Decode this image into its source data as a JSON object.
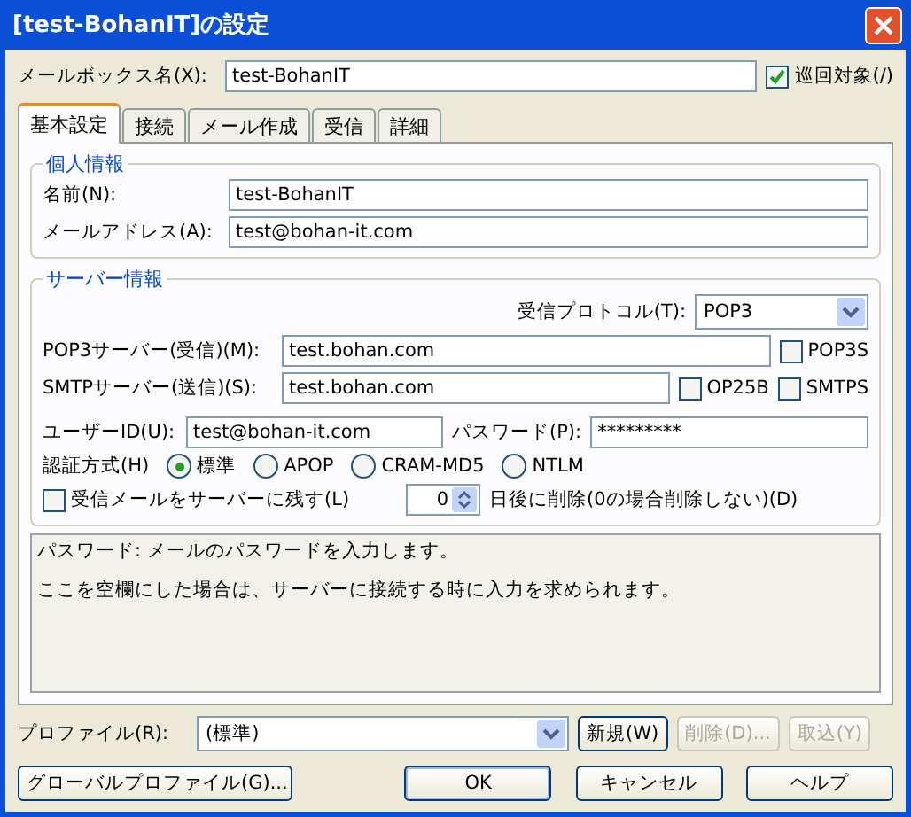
{
  "window": {
    "title": "[test-BohanIT]の設定"
  },
  "mailbox": {
    "label": "メールボックス名(X):",
    "value": "test-BohanIT",
    "patrol": {
      "label": "巡回対象(/)",
      "checked": true
    }
  },
  "tabs": [
    {
      "label": "基本設定",
      "selected": true
    },
    {
      "label": "接続",
      "selected": false
    },
    {
      "label": "メール作成",
      "selected": false
    },
    {
      "label": "受信",
      "selected": false
    },
    {
      "label": "詳細",
      "selected": false
    }
  ],
  "personal": {
    "title": "個人情報",
    "fields": [
      {
        "label": "名前(N):",
        "value": "test-BohanIT"
      },
      {
        "label": "メールアドレス(A):",
        "value": "test@bohan-it.com"
      }
    ]
  },
  "server": {
    "title": "サーバー情報",
    "protocol": {
      "label": "受信プロトコル(T):",
      "value": "POP3"
    },
    "pop3": {
      "label": "POP3サーバー(受信)(M):",
      "value": "test.bohan.com",
      "options": [
        {
          "label": "POP3S",
          "checked": false
        }
      ]
    },
    "smtp": {
      "label": "SMTPサーバー(送信)(S):",
      "value": "test.bohan.com",
      "options": [
        {
          "label": "OP25B",
          "checked": false
        },
        {
          "label": "SMTPS",
          "checked": false
        }
      ]
    },
    "user": {
      "label": "ユーザーID(U):",
      "value": "test@bohan-it.com"
    },
    "password": {
      "label": "パスワード(P):",
      "value": "*********"
    },
    "auth": {
      "label": "認証方式(H)",
      "options": [
        {
          "label": "標準",
          "selected": true
        },
        {
          "label": "APOP",
          "selected": false
        },
        {
          "label": "CRAM-MD5",
          "selected": false
        },
        {
          "label": "NTLM",
          "selected": false
        }
      ]
    },
    "leave": {
      "label": "受信メールをサーバーに残す(L)",
      "checked": false
    },
    "days": {
      "value": "0",
      "label": "日後に削除(0の場合削除しない)(D)"
    }
  },
  "help": [
    "パスワード: メールのパスワードを入力します。",
    "ここを空欄にした場合は、サーバーに接続する時に入力を求められます。"
  ],
  "profile": {
    "label": "プロファイル(R):",
    "value": "(標準)",
    "buttons": [
      {
        "label": "新規(W)",
        "disabled": false
      },
      {
        "label": "削除(D)...",
        "disabled": true
      },
      {
        "label": "取込(Y)",
        "disabled": true
      }
    ]
  },
  "buttons": [
    {
      "label": "グローバルプロファイル(G)...",
      "default": false
    },
    {
      "label": "OK",
      "default": true
    },
    {
      "label": "キャンセル",
      "default": false
    },
    {
      "label": "ヘルプ",
      "default": false
    }
  ]
}
